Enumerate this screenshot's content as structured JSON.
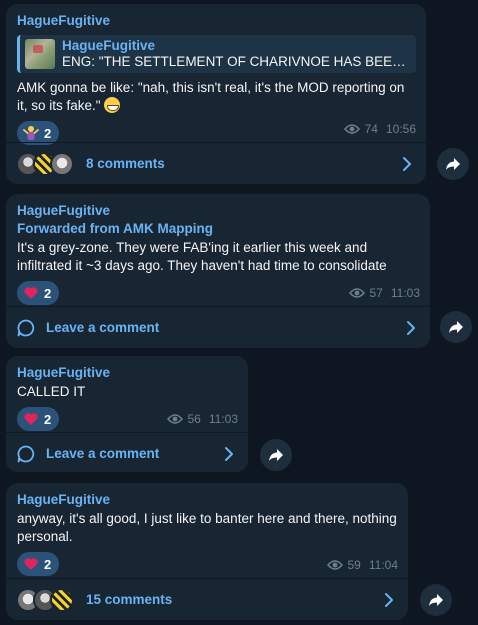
{
  "messages": [
    {
      "author": "HagueFugitive",
      "reply": {
        "author": "HagueFugitive",
        "text": "ENG: \"THE SETTLEMENT OF CHARIVNOE HAS BEEN LIBE..."
      },
      "text": "AMK gonna be like: \"nah, this isn't real, it's the MOD reporting on it, so its fake.\"",
      "reaction": {
        "icon": "person-shrugging-icon",
        "count": "2"
      },
      "views": "74",
      "time": "10:56",
      "comments_label": "8 comments"
    },
    {
      "author": "HagueFugitive",
      "forwarded": "Forwarded from AMK Mapping",
      "text": "It's a grey-zone. They were FAB'ing it earlier this week and infiltrated it ~3 days ago. They haven't had time to consolidate",
      "reaction": {
        "icon": "red-heart-icon",
        "count": "2"
      },
      "views": "57",
      "time": "11:03",
      "comments_label": "Leave a comment"
    },
    {
      "author": "HagueFugitive",
      "text": "CALLED IT",
      "reaction": {
        "icon": "red-heart-icon",
        "count": "2"
      },
      "views": "56",
      "time": "11:03",
      "comments_label": "Leave a comment"
    },
    {
      "author": "HagueFugitive",
      "text": "anyway, it's all good, I just like to banter here and there, nothing personal.",
      "reaction": {
        "icon": "red-heart-icon",
        "count": "2"
      },
      "views": "59",
      "time": "11:04",
      "comments_label": "15 comments"
    }
  ],
  "colors": {
    "background": "#0e1621",
    "bubble": "#182533",
    "accent": "#6ab3f3",
    "reaction_bg": "#2b5278",
    "meta": "#6d7f8f"
  }
}
